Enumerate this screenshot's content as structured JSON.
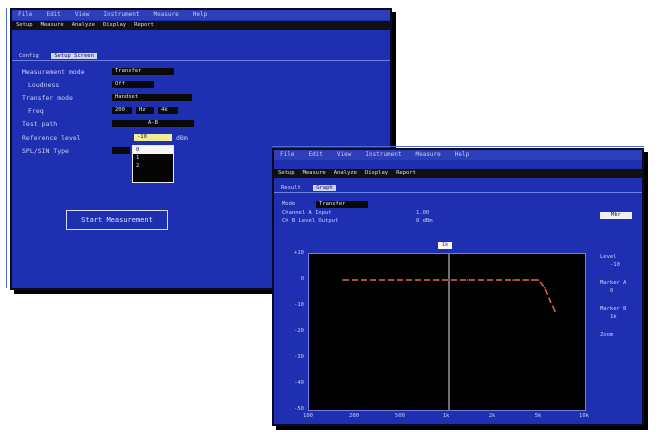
{
  "colors": {
    "window_bg": "#1e2fb2",
    "plot_bg": "#000000",
    "trace": "#e07040",
    "marker_line": "#d8dcf0",
    "highlight": "#f0ec9a"
  },
  "setup_window": {
    "menu": [
      "File",
      "Edit",
      "View",
      "Instrument",
      "Measure",
      "Help"
    ],
    "toolbar": [
      "Setup",
      "Measure",
      "Analyze",
      "Display",
      "Report"
    ],
    "tabs": [
      {
        "label": "Config"
      },
      {
        "label": "Setup Screen"
      }
    ],
    "fields": [
      {
        "label": "Measurement mode",
        "value": "Transfer"
      },
      {
        "label": "Loudness",
        "value": "Off"
      },
      {
        "label": "Transfer mode",
        "value": "Handset"
      },
      {
        "label": "Freq",
        "value": "200",
        "value2": "Hz",
        "value3": "4k"
      },
      {
        "label": "Test path",
        "value": "A-B"
      },
      {
        "label": "Reference level",
        "value": "-10",
        "unit": "dBm"
      },
      {
        "label": "SPL/SIN Type",
        "value": ""
      }
    ],
    "popup_options": [
      "0",
      "1",
      "2"
    ],
    "start_button": "Start Measurement"
  },
  "result_window": {
    "menu": [
      "File",
      "Edit",
      "View",
      "Instrument",
      "Measure",
      "Help"
    ],
    "toolbar": [
      "Setup",
      "Measure",
      "Analyze",
      "Display",
      "Report"
    ],
    "tabs": [
      {
        "label": "Result"
      },
      {
        "label": "Graph"
      }
    ],
    "info": {
      "row1_label": "Mode",
      "row1_value": "Transfer",
      "row2_label": "Channel A  Input",
      "row2_value": "1.00",
      "row3_label": "Ch B Level  Output",
      "row3_value": "0 dBm"
    },
    "cursor_label": "1k",
    "y_ticks": [
      "+10",
      "0",
      "-10",
      "-20",
      "-30",
      "-40",
      "-50"
    ],
    "x_ticks": [
      "100",
      "200",
      "500",
      "1k",
      "2k",
      "5k",
      "10k"
    ],
    "side_panel": {
      "top_select": "Mkr",
      "items": [
        "Level",
        "Marker A",
        "Marker B",
        "Zoom"
      ],
      "values": [
        "-10",
        "0",
        "1k"
      ]
    }
  },
  "chart_data": {
    "type": "line",
    "x": [
      100,
      150,
      200,
      300,
      500,
      800,
      1000,
      1500,
      2000,
      3000,
      4000,
      5000,
      6000,
      7000,
      8000,
      9000,
      10000
    ],
    "series": [
      {
        "values": [
          0,
          0,
          0,
          0,
          0,
          0,
          0,
          0,
          0,
          0,
          0,
          0,
          0,
          0,
          -3,
          -8,
          -12
        ]
      }
    ],
    "xlim": [
      100,
      10000
    ],
    "ylim": [
      -50,
      10
    ],
    "x_scale": "log",
    "grid": false
  }
}
